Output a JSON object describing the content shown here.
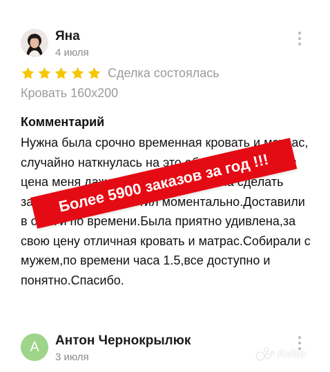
{
  "review_1": {
    "author": "Яна",
    "date": "4 июля",
    "rating": 5,
    "max_rating": 5,
    "deal_status": "Сделка состоялась",
    "product": "Кровать 160х200",
    "comment_heading": "Комментарий",
    "comment_text": "Нужна была срочно временная кровать и матрас, случайно наткнулась на это объявление,низкая цена меня даже удивила, но решила сделать заказ,продавец ответил моментально.Доставили в срок и по времени.Была приятно удивлена,за свою цену отличная кровать и матрас.Собирали с мужем,по времени часа 1.5,все доступно и понятно.Спасибо."
  },
  "review_2": {
    "avatar_letter": "А",
    "author": "Антон Чернокрылюк",
    "date": "3 июля"
  },
  "promo_banner": {
    "text": "Более 5900 заказов  за год !!!"
  },
  "watermark": {
    "text": "Avito"
  },
  "colors": {
    "star": "#f7c600",
    "promo_red": "#e50b14",
    "avatar_green": "#9ed58a",
    "muted_text": "#9b9b9b"
  },
  "icons": {
    "star": "star-icon",
    "menu": "more-vertical-icon",
    "watermark": "avito-logo-icon"
  }
}
